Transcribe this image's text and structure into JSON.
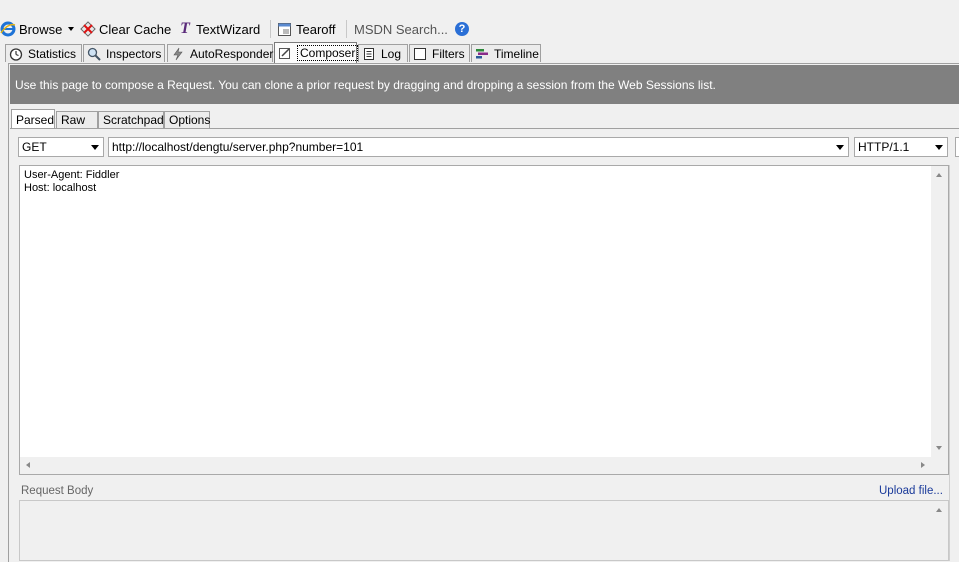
{
  "toolbar": {
    "browse": "Browse",
    "clear_cache": "Clear Cache",
    "text_wizard": "TextWizard",
    "tearoff": "Tearoff",
    "msdn_search": "MSDN Search..."
  },
  "tabs": {
    "statistics": "Statistics",
    "inspectors": "Inspectors",
    "autoresponder": "AutoResponder",
    "composer": "Composer",
    "log": "Log",
    "filters": "Filters",
    "timeline": "Timeline"
  },
  "banner": "Use this page to compose a Request. You can clone a prior request by dragging and dropping a session from the Web Sessions list.",
  "subtabs": {
    "parsed": "Parsed",
    "raw": "Raw",
    "scratchpad": "Scratchpad",
    "options": "Options"
  },
  "request": {
    "method": "GET",
    "url": "http://localhost/dengtu/server.php?number=101",
    "version": "HTTP/1.1",
    "headers": [
      "User-Agent: Fiddler",
      "Host: localhost"
    ]
  },
  "body": {
    "label": "Request Body",
    "upload_link": "Upload file..."
  },
  "colors": {
    "banner": "#808080",
    "link": "#1a3a9a",
    "help_icon": "#2a6fd6"
  }
}
